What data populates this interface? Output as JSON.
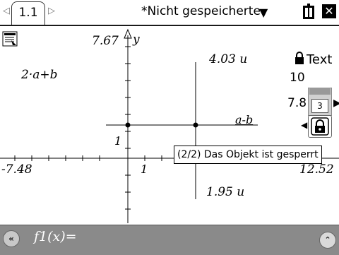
{
  "tabs": {
    "active_label": "1.1"
  },
  "document": {
    "title": "*Nicht gespeicherte"
  },
  "graph": {
    "y_axis_label": "y",
    "y_max": "7.67",
    "x_min": "-7.48",
    "x_max": "12.52",
    "tick_x_one": "1",
    "tick_y_one": "1",
    "expression_sum": "2·a+b",
    "measure_top": "4.03 u",
    "measure_bottom": "1.95 u",
    "label_ab": "a-b"
  },
  "side_panel": {
    "text_label": "Text",
    "value_10": "10",
    "value_78": "7.8",
    "slider_value": "3"
  },
  "tooltip": {
    "text": "(2/2) Das Objekt ist gesperrt"
  },
  "entry_line": {
    "label": "f1(x)="
  },
  "icons": [
    "left-arrow-icon",
    "right-arrow-icon",
    "dropdown-arrow-icon",
    "battery-icon",
    "close-icon",
    "menu-icon",
    "lock-icon",
    "collapse-icon",
    "expand-icon"
  ]
}
